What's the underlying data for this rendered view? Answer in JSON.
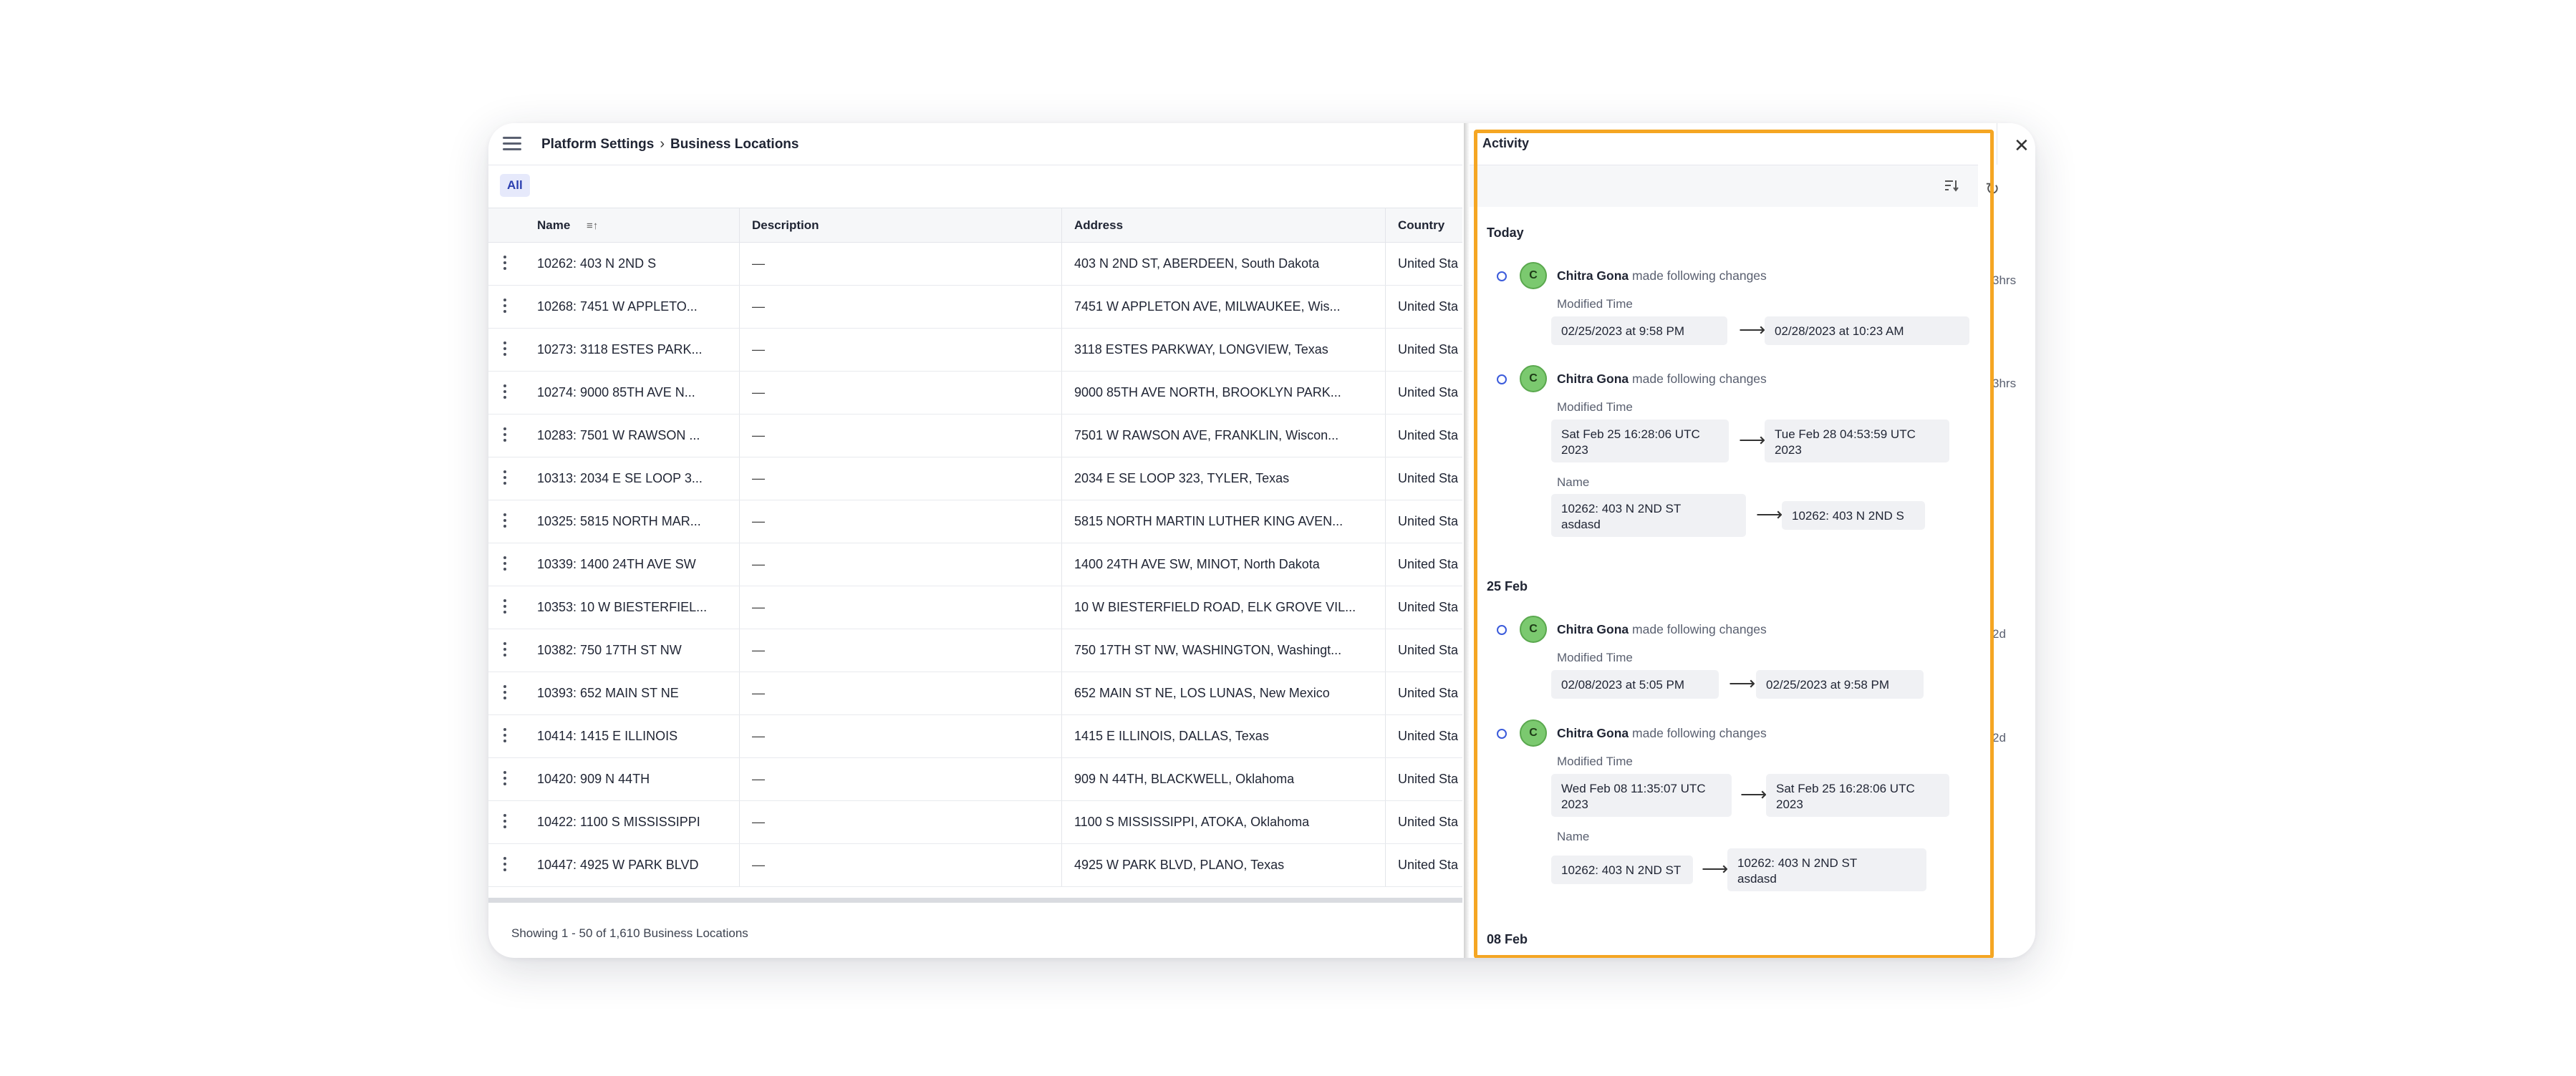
{
  "header": {
    "breadcrumb_root": "Platform Settings",
    "breadcrumb_page": "Business Locations"
  },
  "filters": {
    "all_tab": "All"
  },
  "table": {
    "columns": {
      "name": "Name",
      "description": "Description",
      "address": "Address",
      "country": "Country"
    },
    "rows": [
      {
        "name": "10262: 403 N 2ND S",
        "description": "—",
        "address": "403 N 2ND ST, ABERDEEN, South Dakota",
        "country": "United Sta"
      },
      {
        "name": "10268: 7451 W APPLETO...",
        "description": "—",
        "address": "7451 W APPLETON AVE, MILWAUKEE, Wis...",
        "country": "United Sta"
      },
      {
        "name": "10273: 3118 ESTES PARK...",
        "description": "—",
        "address": "3118 ESTES PARKWAY, LONGVIEW, Texas",
        "country": "United Sta"
      },
      {
        "name": "10274: 9000 85TH AVE N...",
        "description": "—",
        "address": "9000 85TH AVE NORTH, BROOKLYN PARK...",
        "country": "United Sta"
      },
      {
        "name": "10283: 7501 W RAWSON ...",
        "description": "—",
        "address": "7501 W RAWSON AVE, FRANKLIN, Wiscon...",
        "country": "United Sta"
      },
      {
        "name": "10313: 2034 E SE LOOP 3...",
        "description": "—",
        "address": "2034 E SE LOOP 323, TYLER, Texas",
        "country": "United Sta"
      },
      {
        "name": "10325: 5815 NORTH MAR...",
        "description": "—",
        "address": "5815 NORTH MARTIN LUTHER KING AVEN...",
        "country": "United Sta"
      },
      {
        "name": "10339: 1400 24TH AVE SW",
        "description": "—",
        "address": "1400 24TH AVE SW, MINOT, North Dakota",
        "country": "United Sta"
      },
      {
        "name": "10353: 10 W BIESTERFIEL...",
        "description": "—",
        "address": "10 W BIESTERFIELD ROAD, ELK GROVE VIL...",
        "country": "United Sta"
      },
      {
        "name": "10382: 750 17TH ST NW",
        "description": "—",
        "address": "750 17TH ST NW, WASHINGTON, Washingt...",
        "country": "United Sta"
      },
      {
        "name": "10393: 652 MAIN ST NE",
        "description": "—",
        "address": "652 MAIN ST NE, LOS LUNAS, New Mexico",
        "country": "United Sta"
      },
      {
        "name": "10414: 1415 E ILLINOIS",
        "description": "—",
        "address": "1415 E ILLINOIS, DALLAS, Texas",
        "country": "United Sta"
      },
      {
        "name": "10420: 909 N 44TH",
        "description": "—",
        "address": "909 N 44TH, BLACKWELL, Oklahoma",
        "country": "United Sta"
      },
      {
        "name": "10422: 1100 S MISSISSIPPI",
        "description": "—",
        "address": "1100 S MISSISSIPPI, ATOKA, Oklahoma",
        "country": "United Sta"
      },
      {
        "name": "10447: 4925 W PARK BLVD",
        "description": "—",
        "address": "4925 W PARK BLVD, PLANO, Texas",
        "country": "United Sta"
      }
    ]
  },
  "footer": {
    "summary": "Showing 1 - 50 of 1,610 Business Locations"
  },
  "activity": {
    "title": "Activity",
    "groups": {
      "today": "Today",
      "feb25": "25 Feb",
      "feb08": "08 Feb"
    },
    "entries": [
      {
        "initial": "C",
        "user": "Chitra Gona",
        "action": "made following changes",
        "ago": "3hrs",
        "changes": [
          {
            "field": "Modified Time",
            "from": "02/25/2023 at 9:58 PM",
            "to": "02/28/2023 at 10:23 AM"
          }
        ]
      },
      {
        "initial": "C",
        "user": "Chitra Gona",
        "action": "made following changes",
        "ago": "3hrs",
        "changes": [
          {
            "field": "Modified Time",
            "from_1": "Sat Feb 25 16:28:06 UTC",
            "from_2": "2023",
            "to_1": "Tue Feb 28 04:53:59 UTC",
            "to_2": "2023"
          },
          {
            "field": "Name",
            "from_1": "10262: 403 N 2ND ST",
            "from_2": "asdasd",
            "to": "10262: 403 N 2ND S"
          }
        ]
      },
      {
        "initial": "C",
        "user": "Chitra Gona",
        "action": "made following changes",
        "ago": "2d",
        "changes": [
          {
            "field": "Modified Time",
            "from": "02/08/2023 at 5:05 PM",
            "to": "02/25/2023 at 9:58 PM"
          }
        ]
      },
      {
        "initial": "C",
        "user": "Chitra Gona",
        "action": "made following changes",
        "ago": "2d",
        "changes": [
          {
            "field": "Modified Time",
            "from_1": "Wed Feb 08 11:35:07 UTC",
            "from_2": "2023",
            "to_1": "Sat Feb 25 16:28:06 UTC",
            "to_2": "2023"
          },
          {
            "field": "Name",
            "from": "10262: 403 N 2ND ST",
            "to_1": "10262: 403 N 2ND ST",
            "to_2": "asdasd"
          }
        ]
      }
    ]
  },
  "colors": {
    "highlight": "#f5a623",
    "tab_bg": "#e6e9fb",
    "tab_text": "#2b3fb0",
    "avatar": "#7bc96f",
    "timeline_dot": "#3b5bdb"
  },
  "icons": [
    "hamburger-menu-icon",
    "chevron-right-icon",
    "sort-icon",
    "kebab-menu-icon",
    "close-icon",
    "refresh-icon",
    "sort-list-icon",
    "arrow-right-icon"
  ]
}
